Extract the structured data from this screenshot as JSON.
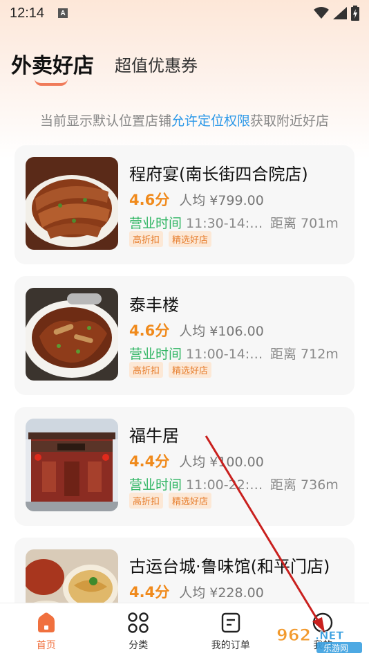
{
  "status": {
    "time": "12:14",
    "notif_letter": "A"
  },
  "tabs": {
    "active": "外卖好店",
    "inactive": "超值优惠券"
  },
  "location_hint": {
    "prefix": "当前显示默认位置店铺",
    "link": "允许定位权限",
    "suffix": "获取附近好店"
  },
  "labels": {
    "hours": "营业时间",
    "distance": "距离"
  },
  "shops": [
    {
      "name": "程府宴(南长街四合院店)",
      "score": "4.6分",
      "avg": "人均 ¥799.00",
      "hours": "11:30-14:0...",
      "distance": "701m",
      "tags": [
        "高折扣",
        "精选好店"
      ]
    },
    {
      "name": "泰丰楼",
      "score": "4.6分",
      "avg": "人均 ¥106.00",
      "hours": "11:00-14:0...",
      "distance": "712m",
      "tags": [
        "高折扣",
        "精选好店"
      ]
    },
    {
      "name": "福牛居",
      "score": "4.4分",
      "avg": "人均 ¥100.00",
      "hours": "11:00-22:00",
      "distance": "736m",
      "tags": [
        "高折扣",
        "精选好店"
      ]
    },
    {
      "name": "古运台城·鲁味馆(和平门店)",
      "score": "4.4分",
      "avg": "人均 ¥228.00",
      "hours": "",
      "distance": "",
      "tags": []
    }
  ],
  "nav": [
    {
      "label": "首页",
      "icon": "home-icon",
      "active": true
    },
    {
      "label": "分类",
      "icon": "grid-icon",
      "active": false
    },
    {
      "label": "我的订单",
      "icon": "order-icon",
      "active": false
    },
    {
      "label": "我的",
      "icon": "profile-icon",
      "active": false
    }
  ],
  "watermark": {
    "text": "962.NET",
    "subtext": "乐游网"
  },
  "colors": {
    "accent": "#f0703e",
    "score": "#f08a1c",
    "open": "#2fb563",
    "link": "#2b98e8"
  }
}
